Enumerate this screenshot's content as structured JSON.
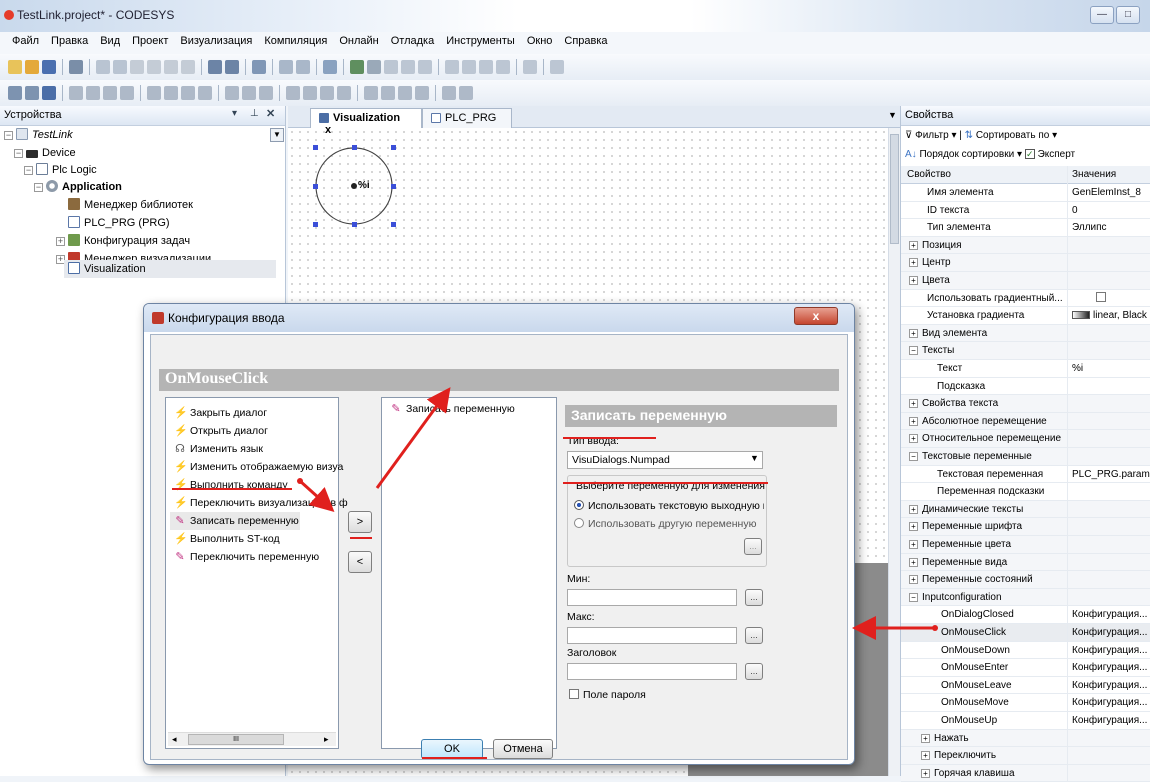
{
  "window": {
    "title": "TestLink.project* - CODESYS",
    "minimize": "—",
    "maximize": "□"
  },
  "menubar": [
    "Файл",
    "Правка",
    "Вид",
    "Проект",
    "Визуализация",
    "Компиляция",
    "Онлайн",
    "Отладка",
    "Инструменты",
    "Окно",
    "Справка"
  ],
  "devices_panel": {
    "title": "Устройства",
    "tree": [
      {
        "label": "TestLink",
        "level": 0,
        "expander": "−",
        "icon": "project-icon"
      },
      {
        "label": "Device",
        "level": 1,
        "expander": "−",
        "icon": "device-icon"
      },
      {
        "label": "Plc Logic",
        "level": 2,
        "expander": "−",
        "icon": "plc-logic-icon"
      },
      {
        "label": "Application",
        "level": 3,
        "expander": "−",
        "icon": "application-icon"
      },
      {
        "label": "Менеджер библиотек",
        "level": 4,
        "expander": "",
        "icon": "library-manager-icon"
      },
      {
        "label": "PLC_PRG (PRG)",
        "level": 4,
        "expander": "",
        "icon": "program-icon"
      },
      {
        "label": "Конфигурация задач",
        "level": 4,
        "expander": "+",
        "icon": "task-config-icon"
      },
      {
        "label": "Менеджер визуализации",
        "level": 4,
        "expander": "+",
        "icon": "visu-manager-icon"
      },
      {
        "label": "Visualization",
        "level": 4,
        "expander": "",
        "icon": "visualization-icon"
      }
    ]
  },
  "editor": {
    "tabs": [
      {
        "label": "Visualization",
        "active": true,
        "close": "x"
      },
      {
        "label": "PLC_PRG",
        "active": false,
        "close": ""
      }
    ],
    "element_text": "%i"
  },
  "properties_panel": {
    "title": "Свойства",
    "filter_label": "Фильтр",
    "sort_label": "Сортировать по",
    "sort_order_label": "Порядок сортировки",
    "expert_label": "Эксперт",
    "col_property": "Свойство",
    "col_value": "Значения",
    "rows": [
      {
        "name": "Имя элемента",
        "value": "GenElemInst_8",
        "exp": ""
      },
      {
        "name": "ID текста",
        "value": "0",
        "exp": ""
      },
      {
        "name": "Тип элемента",
        "value": "Эллипс",
        "exp": ""
      },
      {
        "name": "Позиция",
        "value": "",
        "exp": "+"
      },
      {
        "name": "Центр",
        "value": "",
        "exp": "+"
      },
      {
        "name": "Цвета",
        "value": "",
        "exp": "+"
      },
      {
        "name": "Использовать градиентный...",
        "value": "",
        "exp": ""
      },
      {
        "name": "Установка градиента",
        "value": "linear, Black",
        "exp": ""
      },
      {
        "name": "Вид элемента",
        "value": "",
        "exp": "+"
      },
      {
        "name": "Тексты",
        "value": "",
        "exp": "−"
      },
      {
        "name": "Текст",
        "value": "%i",
        "exp": ""
      },
      {
        "name": "Подсказка",
        "value": "",
        "exp": ""
      },
      {
        "name": "Свойства текста",
        "value": "",
        "exp": "+"
      },
      {
        "name": "Абсолютное перемещение",
        "value": "",
        "exp": "+"
      },
      {
        "name": "Относительное перемещение",
        "value": "",
        "exp": "+"
      },
      {
        "name": "Текстовые переменные",
        "value": "",
        "exp": "−"
      },
      {
        "name": "Текстовая переменная",
        "value": "PLC_PRG.parame",
        "exp": ""
      },
      {
        "name": "Переменная подсказки",
        "value": "",
        "exp": ""
      },
      {
        "name": "Динамические тексты",
        "value": "",
        "exp": "+"
      },
      {
        "name": "Переменные шрифта",
        "value": "",
        "exp": "+"
      },
      {
        "name": "Переменные цвета",
        "value": "",
        "exp": "+"
      },
      {
        "name": "Переменные вида",
        "value": "",
        "exp": "+"
      },
      {
        "name": "Переменные состояний",
        "value": "",
        "exp": "+"
      },
      {
        "name": "Inputconfiguration",
        "value": "",
        "exp": "−"
      },
      {
        "name": "OnDialogClosed",
        "value": "Конфигурация...",
        "exp": ""
      },
      {
        "name": "OnMouseClick",
        "value": "Конфигурация...",
        "exp": ""
      },
      {
        "name": "OnMouseDown",
        "value": "Конфигурация...",
        "exp": ""
      },
      {
        "name": "OnMouseEnter",
        "value": "Конфигурация...",
        "exp": ""
      },
      {
        "name": "OnMouseLeave",
        "value": "Конфигурация...",
        "exp": ""
      },
      {
        "name": "OnMouseMove",
        "value": "Конфигурация...",
        "exp": ""
      },
      {
        "name": "OnMouseUp",
        "value": "Конфигурация...",
        "exp": ""
      },
      {
        "name": "Нажать",
        "value": "",
        "exp": "+"
      },
      {
        "name": "Переключить",
        "value": "",
        "exp": "+"
      },
      {
        "name": "Горячая клавиша",
        "value": "",
        "exp": "+"
      }
    ]
  },
  "dialog": {
    "title": "Конфигурация ввода",
    "close": "x",
    "event_name": "OnMouseClick",
    "actions": [
      "Закрыть диалог",
      "Открыть диалог",
      "Изменить язык",
      "Изменить отображаемую визуа",
      "Выполнить команду",
      "Переключить визуализацию в ф",
      "Записать переменную",
      "Выполнить ST-код",
      "Переключить переменную"
    ],
    "add_btn": ">",
    "remove_btn": "<",
    "configured": [
      "Записать переменную"
    ],
    "config_title": "Записать переменную",
    "input_type_label": "Тип ввода:",
    "input_type_value": "VisuDialogs.Numpad",
    "choose_var_label": "Выберите переменную для изменения",
    "radio_use_text_var": "Использовать текстовую выходную пе",
    "radio_use_other_var": "Использовать другую переменную",
    "min_label": "Мин:",
    "max_label": "Макс:",
    "header_label": "Заголовок",
    "password_label": "Поле пароля",
    "dots": "...",
    "ok_label": "OK",
    "cancel_label": "Отмена",
    "scroll_thumb": "III"
  }
}
